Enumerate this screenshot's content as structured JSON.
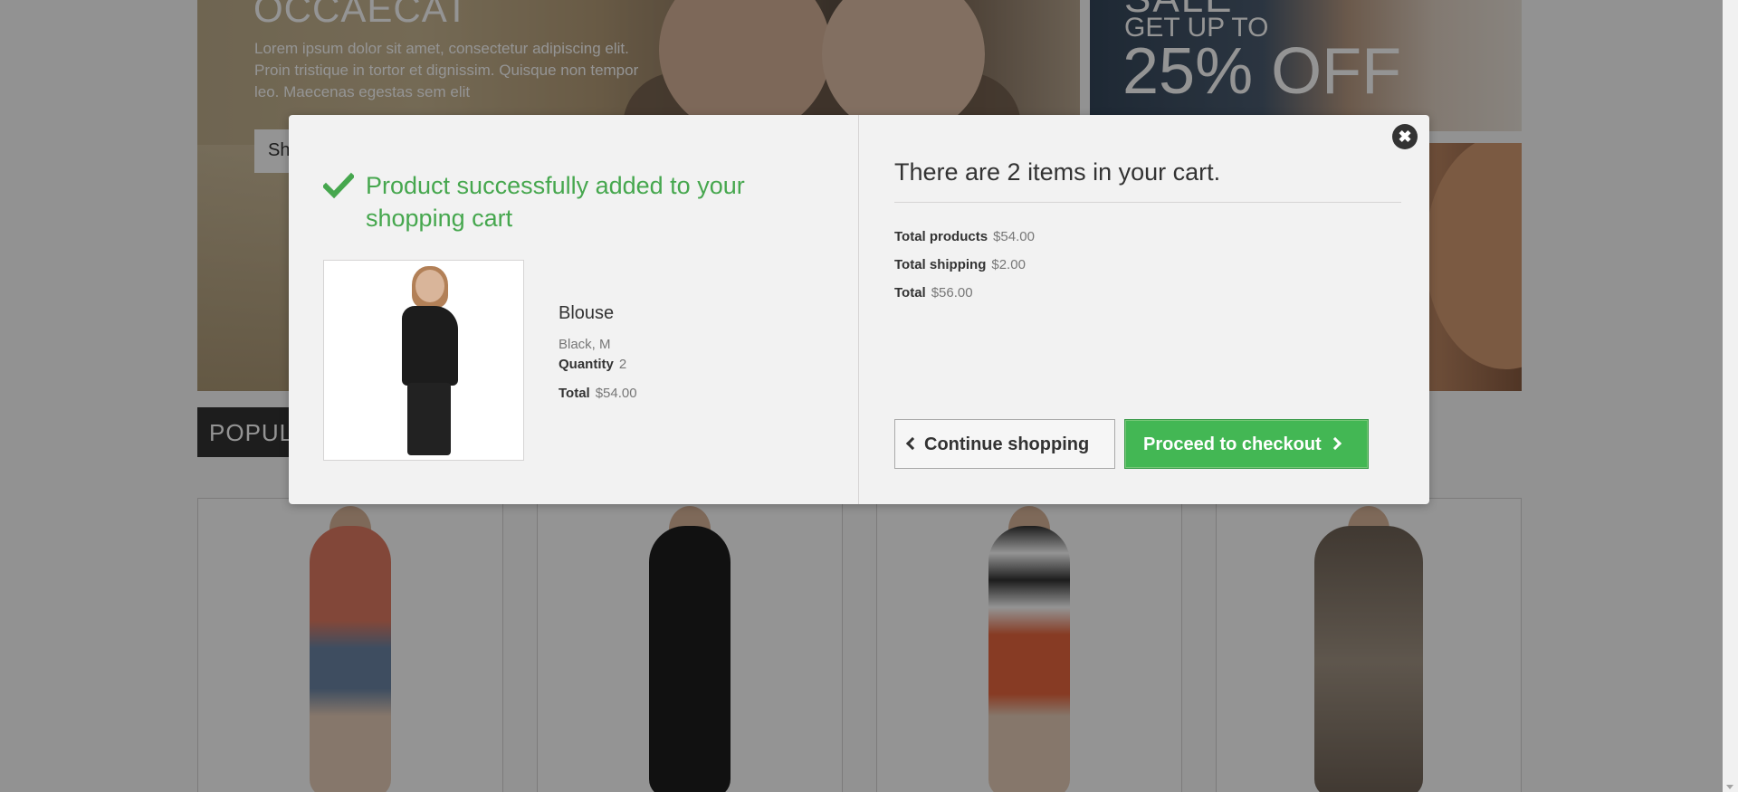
{
  "hero": {
    "title": "OCCAECAT",
    "text": "Lorem ipsum dolor sit amet, consectetur adipiscing elit. Proin tristique in tortor et dignissim. Quisque non tempor leo. Maecenas egestas sem elit",
    "button_label": "Sh"
  },
  "banner": {
    "sale_line1": "SALE",
    "sale_line2": "GET UP TO",
    "sale_line3": "25% OFF"
  },
  "section": {
    "title": "POPULAR"
  },
  "modal": {
    "close_icon": "close-icon",
    "success_icon": "checkmark-icon",
    "success_message": "Product successfully added to your shopping cart",
    "product": {
      "name": "Blouse",
      "attributes": "Black, M",
      "quantity_label": "Quantity",
      "quantity": "2",
      "total_label": "Total",
      "total": "$54.00"
    },
    "cart": {
      "title": "There are 2 items in your cart.",
      "total_products_label": "Total products",
      "total_products": "$54.00",
      "total_shipping_label": "Total shipping",
      "total_shipping": "$2.00",
      "total_label": "Total",
      "total": "$56.00"
    },
    "buttons": {
      "continue_label": "Continue shopping",
      "checkout_label": "Proceed to checkout"
    }
  },
  "colors": {
    "success_green": "#46a74e",
    "checkout_button": "#43b754",
    "overlay": "rgba(0,0,0,0.42)"
  }
}
